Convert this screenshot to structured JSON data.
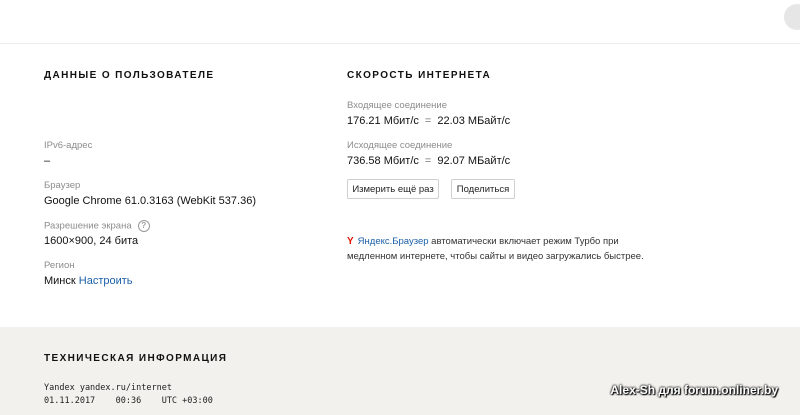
{
  "user_info": {
    "heading": "ДАННЫЕ О ПОЛЬЗОВАТЕЛЕ",
    "ipv6_label": "IPv6-адрес",
    "ipv6_value": "–",
    "browser_label": "Браузер",
    "browser_value": "Google Chrome 61.0.3163 (WebKit 537.36)",
    "screen_label": "Разрешение экрана",
    "screen_help": "?",
    "screen_value": "1600×900, 24 бита",
    "region_label": "Регион",
    "region_value": "Минск",
    "region_link": "Настроить"
  },
  "speed": {
    "heading": "СКОРОСТЬ ИНТЕРНЕТА",
    "incoming_label": "Входящее соединение",
    "incoming_mbit": "176.21 Мбит/с",
    "incoming_eq": "=",
    "incoming_mbyte": "22.03 МБайт/с",
    "outgoing_label": "Исходящее соединение",
    "outgoing_mbit": "736.58 Мбит/с",
    "outgoing_eq": "=",
    "outgoing_mbyte": "92.07 МБайт/с",
    "retest_button": "Измерить ещё раз",
    "share_button": "Поделиться"
  },
  "promo": {
    "icon": "yandex-y-icon",
    "icon_glyph": "Y",
    "link_text": "Яндекс.Браузер",
    "text": " автоматически включает режим Турбо при медленном интернете, чтобы сайты и видео загружались быстрее."
  },
  "tech": {
    "heading": "ТЕХНИЧЕСКАЯ ИНФОРМАЦИЯ",
    "line1": "Yandex yandex.ru/internet",
    "line2": "01.11.2017    00:36    UTC +03:00"
  },
  "watermark": "Alex-Sh для forum.onliner.by",
  "colors": {
    "link": "#1a5fa8",
    "footer_bg": "#f2f1ed",
    "yandex_red": "#e61400"
  }
}
